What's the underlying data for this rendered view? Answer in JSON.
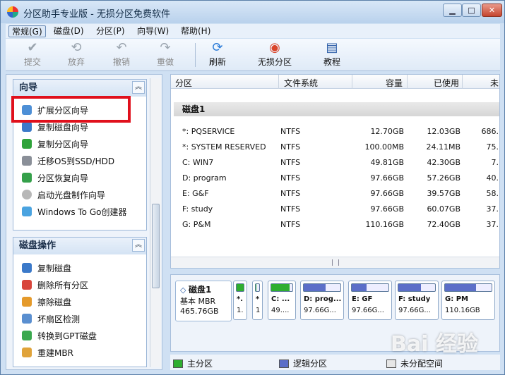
{
  "window": {
    "title": "分区助手专业版 - 无损分区免费软件"
  },
  "menubar": [
    "常规(G)",
    "磁盘(D)",
    "分区(P)",
    "向导(W)",
    "帮助(H)"
  ],
  "toolbar": {
    "commit": "提交",
    "discard": "放弃",
    "undo": "撤销",
    "redo": "重做",
    "refresh": "刷新",
    "lossless": "无损分区",
    "tutorial": "教程"
  },
  "wizard": {
    "title": "向导",
    "items": [
      "扩展分区向导",
      "复制磁盘向导",
      "复制分区向导",
      "迁移OS到SSD/HDD",
      "分区恢复向导",
      "启动光盘制作向导",
      "Windows To Go创建器"
    ]
  },
  "disk_ops": {
    "title": "磁盘操作",
    "items": [
      "复制磁盘",
      "删除所有分区",
      "擦除磁盘",
      "坏扇区检测",
      "转换到GPT磁盘",
      "重建MBR"
    ]
  },
  "table": {
    "columns": [
      "分区",
      "文件系统",
      "容量",
      "已使用",
      "未"
    ],
    "disk_label": "磁盘1",
    "rows": [
      {
        "name": "*: PQSERVICE",
        "fs": "NTFS",
        "cap": "12.70GB",
        "used": "12.03GB",
        "free": "686."
      },
      {
        "name": "*: SYSTEM RESERVED",
        "fs": "NTFS",
        "cap": "100.00MB",
        "used": "24.11MB",
        "free": "75."
      },
      {
        "name": "C: WIN7",
        "fs": "NTFS",
        "cap": "49.81GB",
        "used": "42.30GB",
        "free": "7."
      },
      {
        "name": "D: program",
        "fs": "NTFS",
        "cap": "97.66GB",
        "used": "57.26GB",
        "free": "40."
      },
      {
        "name": "E: G&F",
        "fs": "NTFS",
        "cap": "97.66GB",
        "used": "39.57GB",
        "free": "58."
      },
      {
        "name": "F: study",
        "fs": "NTFS",
        "cap": "97.66GB",
        "used": "60.07GB",
        "free": "37."
      },
      {
        "name": "G: P&M",
        "fs": "NTFS",
        "cap": "110.16GB",
        "used": "72.40GB",
        "free": "37."
      }
    ]
  },
  "diskmap": {
    "disk": {
      "name": "磁盘1",
      "type": "基本 MBR",
      "size": "465.76GB"
    },
    "parts": [
      {
        "l1": "*.",
        "l2": "1.",
        "fill": 0.95,
        "kind": "primary"
      },
      {
        "l1": "*",
        "l2": "1",
        "fill": 0.25,
        "kind": "primary"
      },
      {
        "l1": "C: ...",
        "l2": "49....",
        "fill": 0.85,
        "kind": "primary"
      },
      {
        "l1": "D: prog...",
        "l2": "97.66G...",
        "fill": 0.59,
        "kind": "logical"
      },
      {
        "l1": "E: GF",
        "l2": "97.66G...",
        "fill": 0.41,
        "kind": "logical"
      },
      {
        "l1": "F: study",
        "l2": "97.66G...",
        "fill": 0.62,
        "kind": "logical"
      },
      {
        "l1": "G: PM",
        "l2": "110.16GB",
        "fill": 0.66,
        "kind": "logical"
      }
    ]
  },
  "legend": {
    "primary": "主分区",
    "logical": "逻辑分区",
    "unallocated": "未分配空间"
  },
  "watermark": "Bai 经验",
  "colors": {
    "primary": "#2fae2f",
    "logical": "#5b6ec8",
    "highlight": "#e0101c"
  }
}
